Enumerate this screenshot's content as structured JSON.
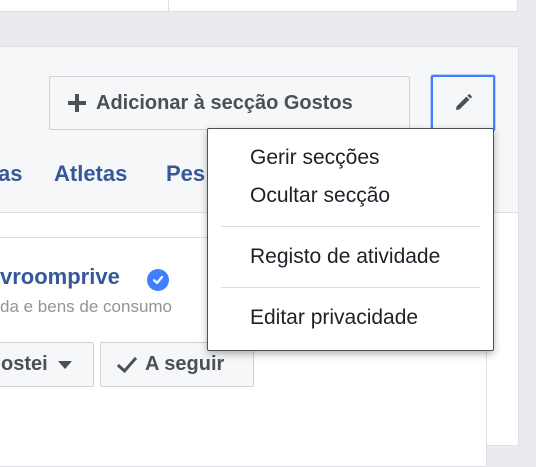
{
  "header": {
    "add_likes_label": "Adicionar à secção Gostos"
  },
  "tabs": [
    {
      "label": "as"
    },
    {
      "label": "Atletas"
    },
    {
      "label": "Pes"
    }
  ],
  "item": {
    "name": "vroomprive",
    "category": "da e bens de consumo",
    "liked_label": "ostei",
    "following_label": "A seguir"
  },
  "menu": {
    "group1": [
      {
        "label": "Gerir secções"
      },
      {
        "label": "Ocultar secção"
      }
    ],
    "group2": [
      {
        "label": "Registo de atividade"
      }
    ],
    "group3": [
      {
        "label": "Editar privacidade"
      }
    ]
  },
  "colors": {
    "link": "#365899",
    "focus": "#4080ff",
    "verified": "#4080ff",
    "button_bg": "#f6f7f9",
    "button_text": "#4b4f56"
  },
  "icons": [
    "plus-icon",
    "pencil-icon",
    "verified-badge-icon",
    "caret-down-icon",
    "checkmark-icon"
  ]
}
